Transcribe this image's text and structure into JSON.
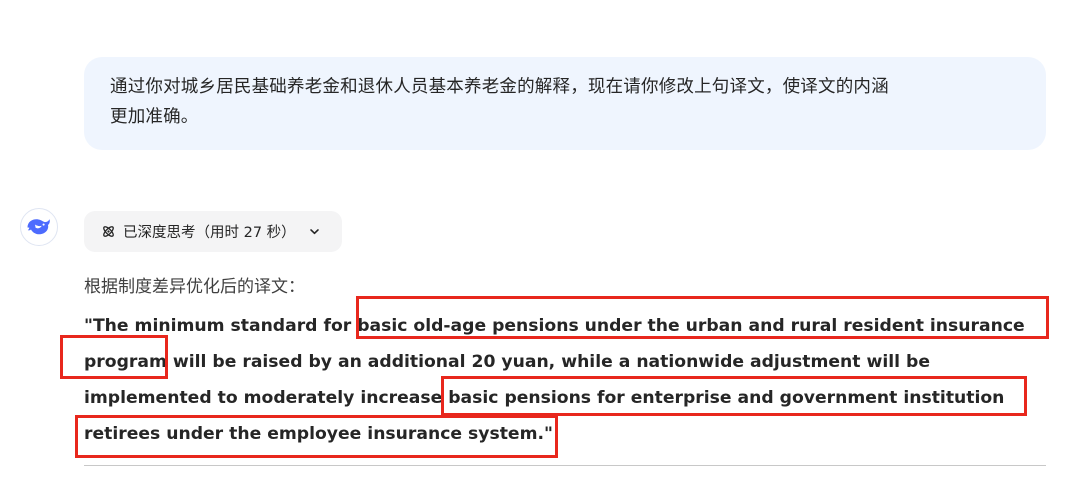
{
  "user_message": {
    "text": "通过你对城乡居民基础养老金和退休人员基本养老金的解释，现在请你修改上句译文，使译文的内涵更加准确。",
    "line1": "通过你对城乡居民基础养老金和退休人员基本养老金的解释，现在请你修改上句译文，使译文的内涵",
    "line2": "更加准确。"
  },
  "assistant": {
    "avatar_icon": "whale-icon",
    "think_chip": {
      "icon": "atom-icon",
      "label": "已深度思考（用时 27 秒）",
      "chevron_icon": "chevron-down-icon"
    },
    "intro": "根据制度差异优化后的译文：",
    "answer_lines": [
      "\"The minimum standard for basic old-age pensions under the urban and rural resident insurance",
      "program will be raised by an additional 20 yuan, while a nationwide adjustment will be",
      "implemented to moderately increase basic pensions for enterprise and government institution",
      "retirees under the employee insurance system.\""
    ],
    "highlighted_phrases": [
      "basic old-age pensions under the urban and rural resident insurance",
      "program",
      "basic pensions for enterprise and government institution",
      "retirees under the employee insurance system."
    ]
  },
  "colors": {
    "user_bubble": "#eff5fe",
    "chip_bg": "#f4f4f5",
    "highlight_box": "#e8271d",
    "brand_blue": "#4d6bfe",
    "text": "#262626"
  }
}
